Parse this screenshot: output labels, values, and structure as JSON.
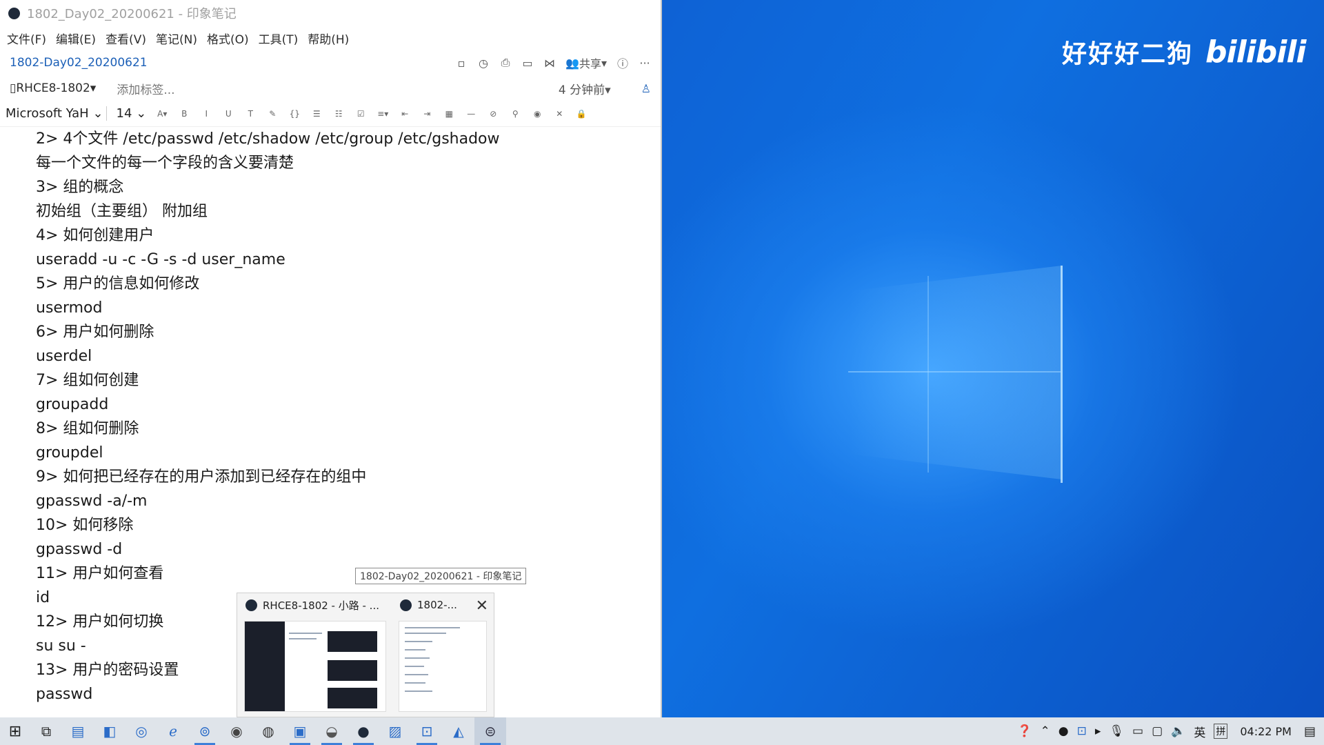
{
  "window": {
    "title": "1802_Day02_20200621 - 印象笔记"
  },
  "menu": [
    "文件(F)",
    "编辑(E)",
    "查看(V)",
    "笔记(N)",
    "格式(O)",
    "工具(T)",
    "帮助(H)"
  ],
  "note_header": {
    "note_title": "1802-Day02_20200621",
    "share_label": "共享",
    "more_label": "···",
    "notebook": "RHCE8-1802",
    "add_tag": "添加标签...",
    "time_ago": "4 分钟前"
  },
  "format_bar": {
    "font_family": "Microsoft YaH",
    "font_size": "14"
  },
  "content_lines": [
    "2> 4个文件 /etc/passwd /etc/shadow /etc/group /etc/gshadow",
    "每一个文件的每一个字段的含义要清楚",
    "3> 组的概念",
    "初始组（主要组） 附加组",
    "4> 如何创建用户",
    "useradd -u -c -G -s -d user_name",
    "5> 用户的信息如何修改",
    "usermod",
    "6> 用户如何删除",
    "userdel",
    "7> 组如何创建",
    "groupadd",
    "8> 组如何删除",
    "groupdel",
    "9> 如何把已经存在的用户添加到已经存在的组中",
    "gpasswd -a/-m",
    "10> 如何移除",
    "gpasswd -d",
    "11> 用户如何查看",
    "id",
    "12> 用户如何切换",
    "su su -",
    "13> 用户的密码设置",
    "passwd"
  ],
  "taskbar_preview": {
    "tooltip": "1802-Day02_20200621 - 印象笔记",
    "card1_title": "RHCE8-1802 - 小路 - ...",
    "card2_title": "1802-..."
  },
  "watermark": {
    "text": "好好好二狗",
    "logo": "bilibili"
  },
  "tray": {
    "ime_lang": "英",
    "ime_mode": "拼",
    "clock": "04:22 PM"
  }
}
